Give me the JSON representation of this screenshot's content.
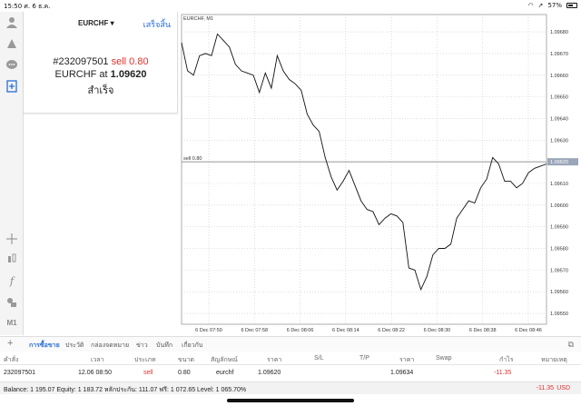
{
  "status_bar": {
    "time": "15:50",
    "date": "ศ. 6 ธ.ค.",
    "battery": "57%"
  },
  "trade_panel": {
    "symbol": "EURCHF",
    "symbol_arrow": "▾",
    "done_label": "เสร็จสิ้น",
    "order_id": "#232097501",
    "order_type": "sell 0.80",
    "symbol_at": "EURCHF at",
    "price": "1.09620",
    "result": "สำเร็จ"
  },
  "chart": {
    "title": "EURCHF, M1",
    "order_line_label": "sell 0.80",
    "current_price_label": "1.09620"
  },
  "chart_data": {
    "type": "line",
    "title": "EURCHF, M1",
    "x_ticks": [
      "6 Dec 07:50",
      "6 Dec 07:58",
      "6 Dec 08:06",
      "6 Dec 08:14",
      "6 Dec 08:22",
      "6 Dec 08:30",
      "6 Dec 08:38",
      "6 Dec 08:46"
    ],
    "y_ticks": [
      "1.09680",
      "1.09670",
      "1.09660",
      "1.09650",
      "1.09640",
      "1.09630",
      "1.09620",
      "1.09610",
      "1.09600",
      "1.09590",
      "1.09580",
      "1.09570",
      "1.09560",
      "1.09550"
    ],
    "ylim": [
      1.09545,
      1.09688
    ],
    "order_line": {
      "label": "sell 0.80",
      "price": 1.0962
    },
    "current_price": "1.09620",
    "series": [
      {
        "values": [
          1.09675,
          1.09662,
          1.0966,
          1.09669,
          1.0967,
          1.09669,
          1.09679,
          1.09676,
          1.09673,
          1.09665,
          1.09662,
          1.09661,
          1.0966,
          1.09652,
          1.09661,
          1.09654,
          1.09669,
          1.09662,
          1.09658,
          1.09656,
          1.09653,
          1.09642,
          1.09637,
          1.09634,
          1.09622,
          1.09613,
          1.09607,
          1.09611,
          1.09616,
          1.09609,
          1.09602,
          1.09598,
          1.09597,
          1.09591,
          1.09594,
          1.09596,
          1.09595,
          1.09592,
          1.09571,
          1.0957,
          1.09561,
          1.09567,
          1.09577,
          1.0958,
          1.0958,
          1.09582,
          1.09594,
          1.09598,
          1.09602,
          1.09601,
          1.09608,
          1.09612,
          1.09622,
          1.09619,
          1.09611,
          1.09611,
          1.09608,
          1.0961,
          1.09615,
          1.09617,
          1.09618,
          1.09619
        ]
      }
    ],
    "grid": true
  },
  "tabs": {
    "items": [
      {
        "label": "การซื้อขาย",
        "active": true
      },
      {
        "label": "ประวัติ"
      },
      {
        "label": "กล่องจดหมาย"
      },
      {
        "label": "ข่าว"
      },
      {
        "label": "บันทึก"
      },
      {
        "label": "เกี่ยวกับ"
      }
    ]
  },
  "table": {
    "headers": [
      "คำสั่ง",
      "เวลา",
      "ประเภท",
      "ขนาด",
      "สัญลักษณ์",
      "ราคา",
      "S/L",
      "T/P",
      "ราคา",
      "Swap",
      "กำไร",
      "หมายเหตุ"
    ],
    "row": [
      "232097501",
      "12.06 08:50",
      "sell",
      "0.80",
      "eurchf",
      "1.09620",
      "",
      "",
      "1.09634",
      "",
      "-11.35",
      ""
    ]
  },
  "balance": {
    "text": "Balance: 1 195.07 Equity: 1 183.72 หลักประกัน: 111.07 ฟรี: 1 072.65 Level: 1 065.70%",
    "profit": "-11.35",
    "currency": "USD"
  },
  "colors": {
    "accent": "#2a6fd6",
    "sell": "#e0312b",
    "line": "#111111",
    "grid": "#c9c9c9",
    "price_tag": "#9aa6b8"
  }
}
